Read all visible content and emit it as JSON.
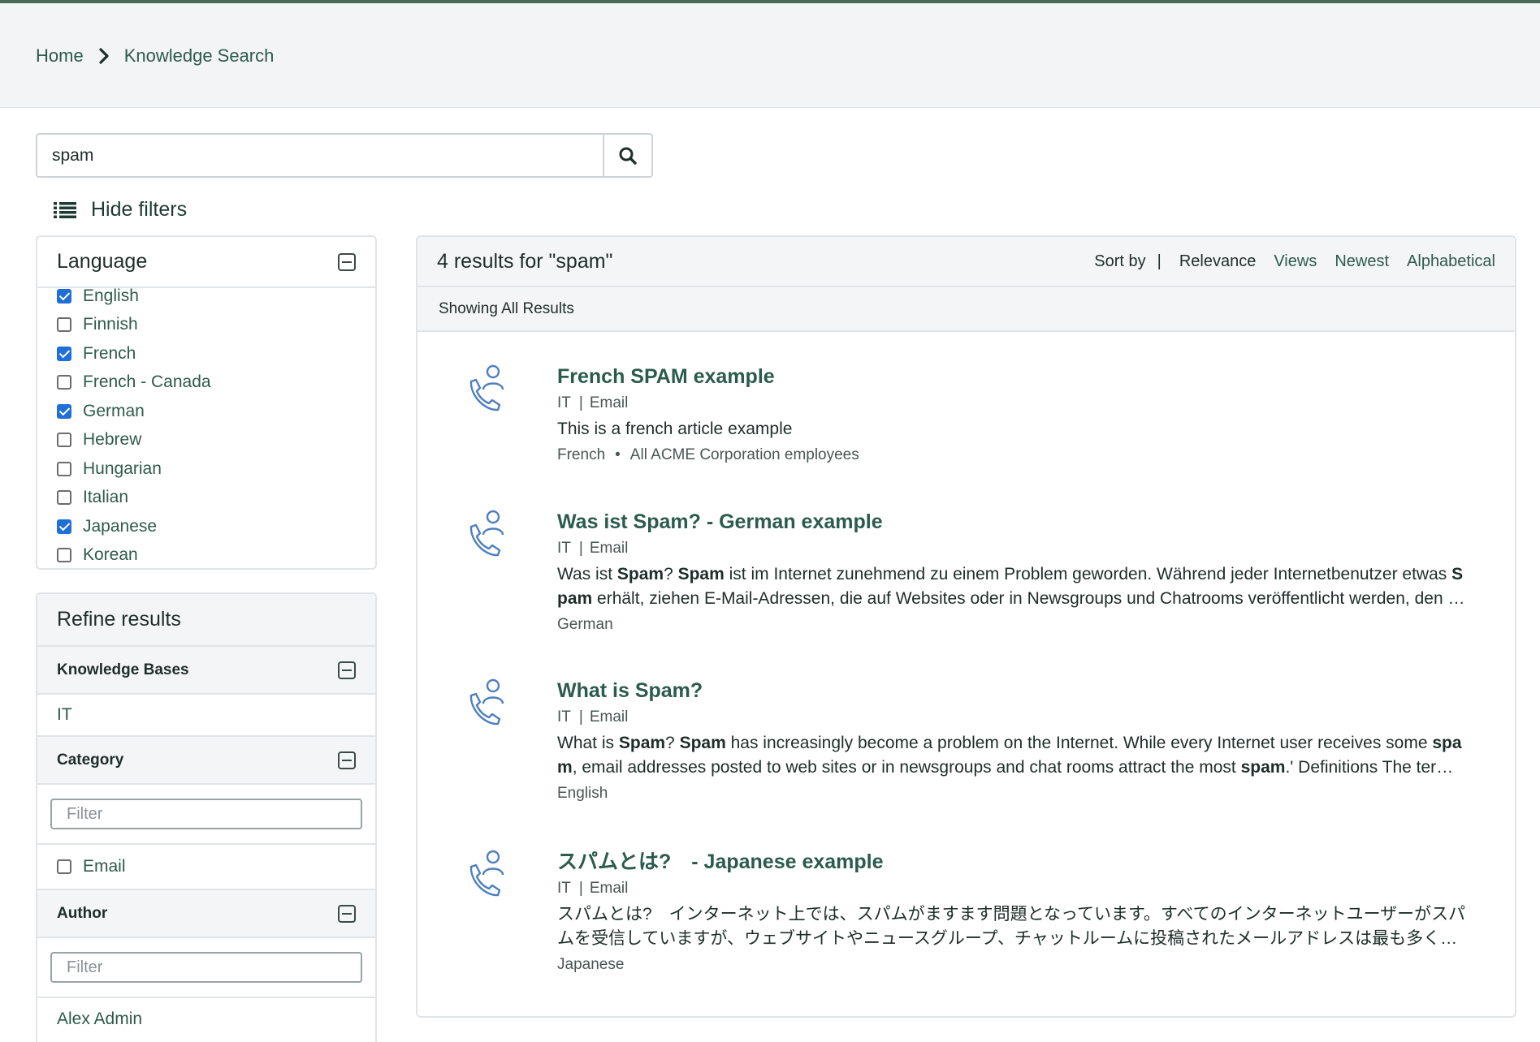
{
  "breadcrumb": {
    "home": "Home",
    "current": "Knowledge Search"
  },
  "search": {
    "value": "spam",
    "button_icon": "search-icon"
  },
  "filters_toggle": {
    "label": "Hide filters",
    "icon": "list-icon"
  },
  "language_panel": {
    "title": "Language",
    "items": [
      {
        "label": "English",
        "checked": true
      },
      {
        "label": "Finnish",
        "checked": false
      },
      {
        "label": "French",
        "checked": true
      },
      {
        "label": "French - Canada",
        "checked": false
      },
      {
        "label": "German",
        "checked": true
      },
      {
        "label": "Hebrew",
        "checked": false
      },
      {
        "label": "Hungarian",
        "checked": false
      },
      {
        "label": "Italian",
        "checked": false
      },
      {
        "label": "Japanese",
        "checked": true
      },
      {
        "label": "Korean",
        "checked": false
      }
    ]
  },
  "refine": {
    "title": "Refine results",
    "knowledge_bases": {
      "title": "Knowledge Bases",
      "items": [
        "IT"
      ]
    },
    "category": {
      "title": "Category",
      "filter_placeholder": "Filter",
      "items": [
        {
          "label": "Email",
          "checked": false
        }
      ]
    },
    "author": {
      "title": "Author",
      "filter_placeholder": "Filter",
      "items": [
        "Alex Admin"
      ]
    }
  },
  "results": {
    "count_label": "4 results for \"spam\"",
    "sort": {
      "label": "Sort by",
      "separator": "|",
      "options": [
        "Relevance",
        "Views",
        "Newest",
        "Alphabetical"
      ],
      "active": "Relevance"
    },
    "showing": "Showing All Results",
    "items": [
      {
        "title": "French SPAM example",
        "kb": "IT",
        "category": "Email",
        "meta_sep": "|",
        "desc_parts": [
          "This is a french article example"
        ],
        "language": "French",
        "dot": "•",
        "audience": "All ACME Corporation employees"
      },
      {
        "title": "Was ist Spam? - German example",
        "kb": "IT",
        "category": "Email",
        "meta_sep": "|",
        "desc_parts": [
          "Was ist ",
          "Spam",
          "? ",
          "Spam",
          " ist im Internet zunehmend zu einem Problem geworden. Während jeder Internetbenutzer etwas ",
          "Spam",
          " erhält, ziehen E-Mail-Adressen, die auf Websites oder in Newsgroups und Chatrooms veröffentlicht werden, den meisten Spam an..."
        ],
        "language": "German"
      },
      {
        "title": "What is Spam?",
        "kb": "IT",
        "category": "Email",
        "meta_sep": "|",
        "desc_parts": [
          "What is ",
          "Spam",
          "? ",
          "Spam",
          " has increasingly become a problem on the Internet. While every Internet user receives some ",
          "spam",
          ", email addresses posted to web sites or in newsgroups and chat rooms attract the most ",
          "spam",
          ".' Definitions The term spam..."
        ],
        "language": "English"
      },
      {
        "title": "スパムとは?　- Japanese example",
        "kb": "IT",
        "category": "Email",
        "meta_sep": "|",
        "desc_parts": [
          "スパムとは?　インターネット上では、スパムがますます問題となっています。すべてのインターネットユーザーがスパムを受信していますが、ウェブサイトやニュースグループ、チャットルームに投稿されたメールアドレスは最も多くのスパムを受け取ります。"
        ],
        "language": "Japanese"
      }
    ]
  }
}
